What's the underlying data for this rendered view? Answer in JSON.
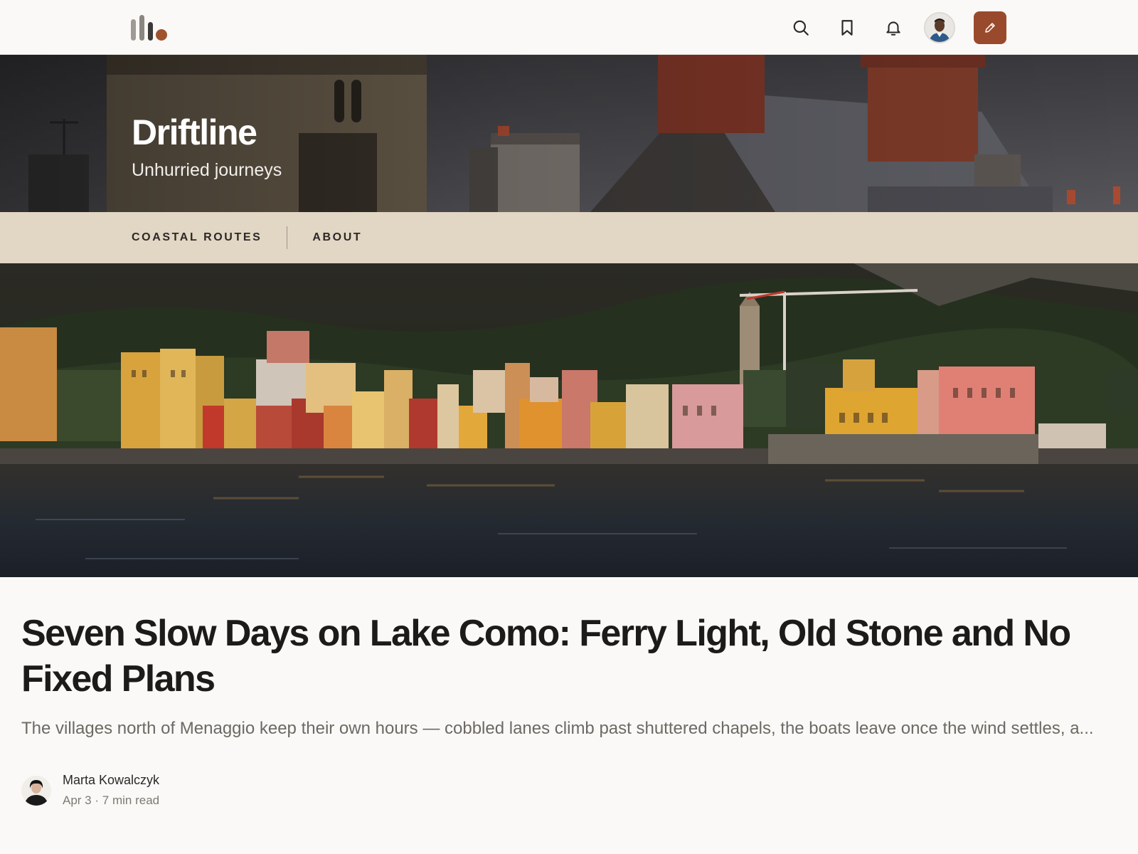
{
  "theme": {
    "accent": "#9a4a2c",
    "nav_background": "#e2d6c4",
    "page_background": "#faf9f7"
  },
  "header": {
    "logo_icon": "bars-logo-icon",
    "actions": {
      "search_icon": "search-icon",
      "bookmark_icon": "bookmark-icon",
      "notifications_icon": "bell-icon",
      "profile_icon": "user-avatar",
      "write_icon": "pencil-icon"
    }
  },
  "blog": {
    "title": "Driftline",
    "tagline": "Unhurried journeys"
  },
  "nav": {
    "items": [
      {
        "label": "COASTAL ROUTES"
      },
      {
        "label": "ABOUT"
      }
    ]
  },
  "article": {
    "title": "Seven Slow Days on Lake Como: Ferry Light, Old Stone and No Fixed Plans",
    "excerpt": "The villages north of Menaggio keep their own hours — cobbled lanes climb past shuttered chapels, the boats leave once the wind settles, a...",
    "author": {
      "name": "Marta Kowalczyk"
    },
    "date": "Apr 3",
    "separator": "·",
    "read_time": "7 min read"
  }
}
